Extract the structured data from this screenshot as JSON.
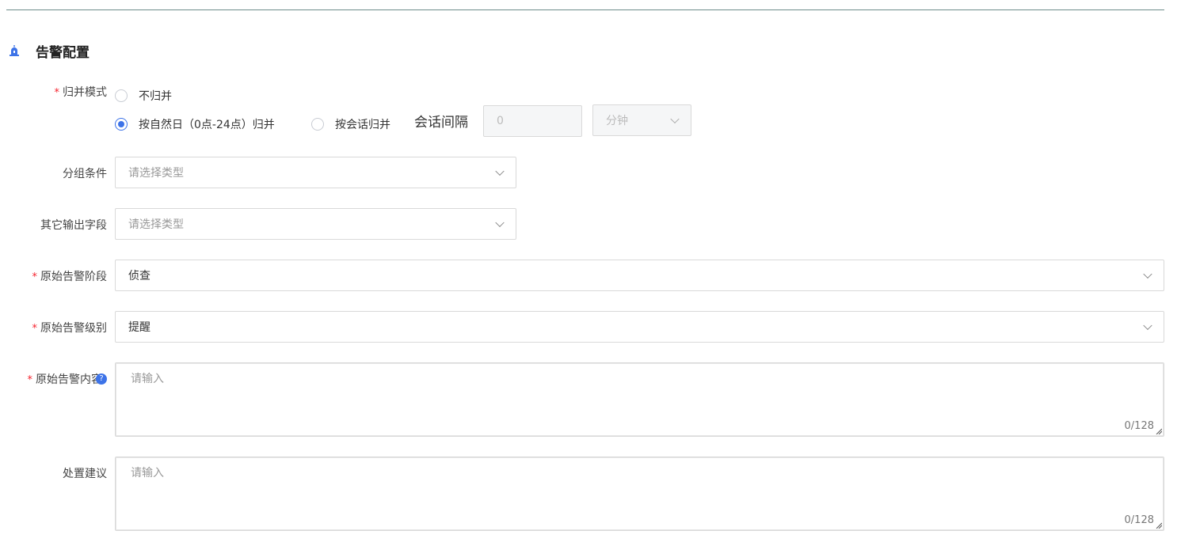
{
  "section": {
    "title": "告警配置",
    "icon": "alarm-icon"
  },
  "merge_mode": {
    "label": "归并模式",
    "required_mark": "*",
    "options": [
      "不归并",
      "按自然日（0点-24点）归并",
      "按会话归并"
    ],
    "selected": "按自然日（0点-24点）归并",
    "session_gap_label": "会话间隔",
    "session_gap_value": "0",
    "unit_select": "分钟"
  },
  "group_condition": {
    "label": "分组条件",
    "placeholder": "请选择类型"
  },
  "other_fields": {
    "label": "其它输出字段",
    "placeholder": "请选择类型"
  },
  "alarm_stage": {
    "label": "原始告警阶段",
    "required_mark": "*",
    "value": "侦查"
  },
  "alarm_level": {
    "label": "原始告警级别",
    "required_mark": "*",
    "value": "提醒"
  },
  "alarm_content": {
    "label": "原始告警内容",
    "required_mark": "*",
    "placeholder": "请输入",
    "count": "0/128",
    "help_icon": "?"
  },
  "suggestion": {
    "label": "处置建议",
    "placeholder": "请输入",
    "count": "0/128"
  },
  "colors": {
    "accent": "#3d73e8",
    "required": "#f5222d",
    "border": "#d9d9d9"
  }
}
